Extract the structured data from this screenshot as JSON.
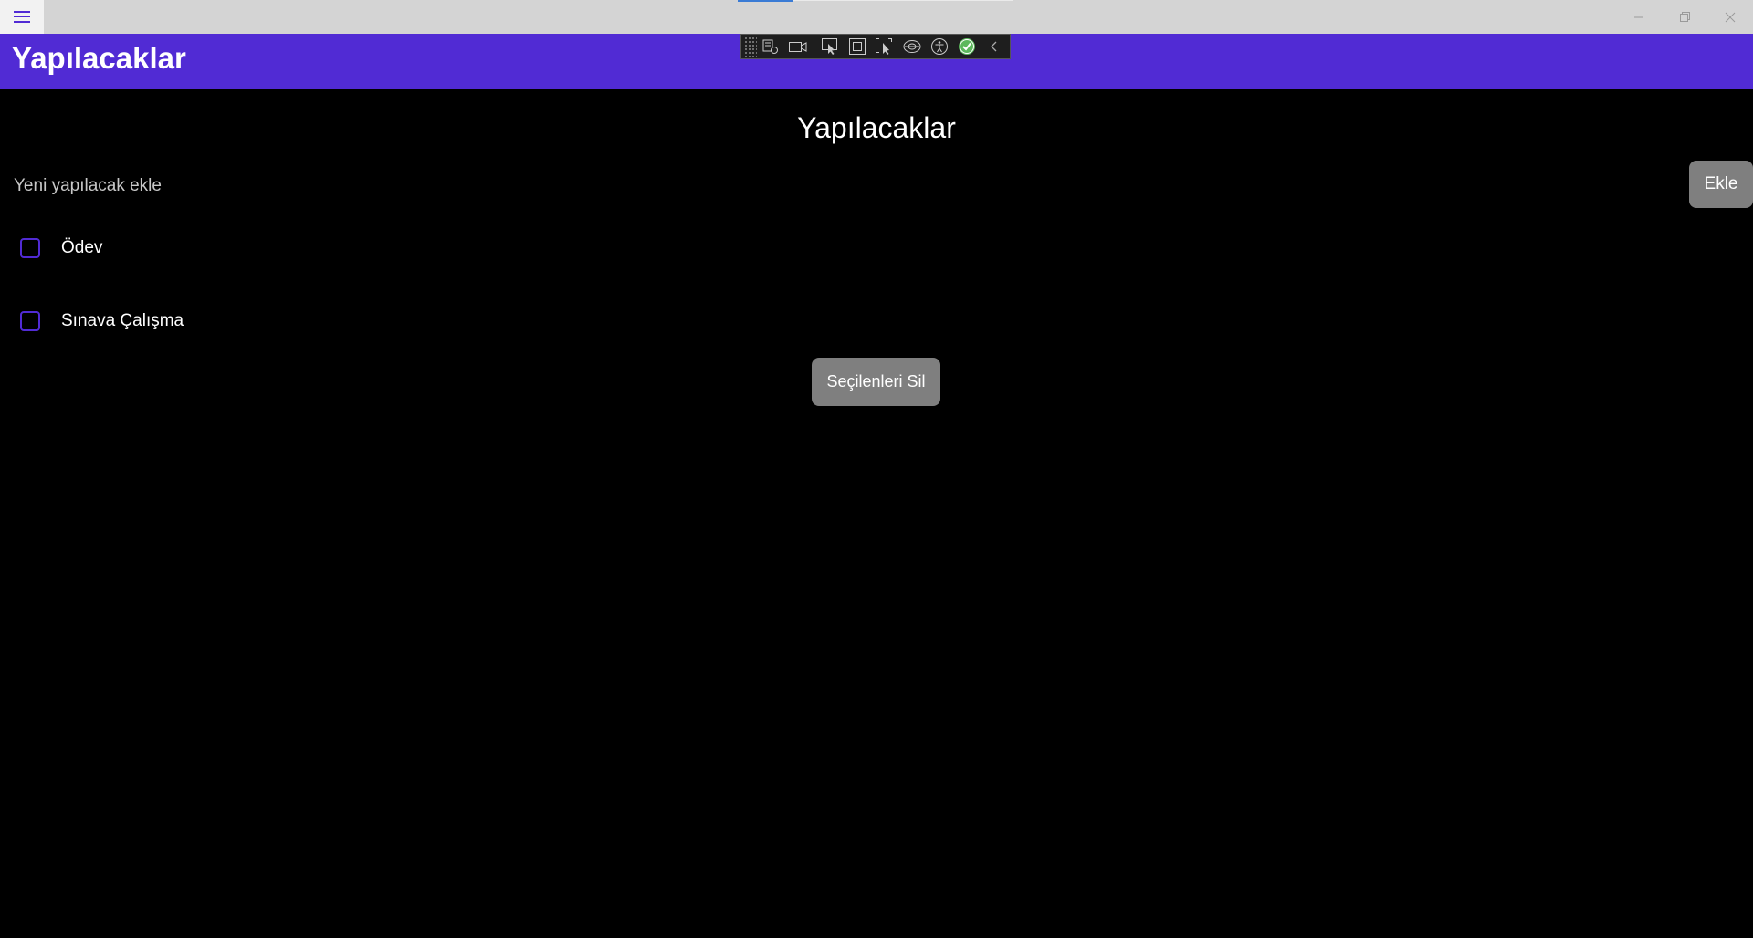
{
  "titlebar": {
    "menu_icon": "hamburger-icon",
    "controls": [
      "minimize-icon",
      "maximize-icon",
      "close-icon"
    ]
  },
  "header": {
    "title": "Yapılacaklar"
  },
  "devtoolbar": {
    "tools": [
      "live-visual-tree-icon",
      "record-icon",
      "select-element-icon",
      "display-layout-adorners-icon",
      "track-focus-icon",
      "binding-failures-icon",
      "accessibility-icon",
      "hot-reload-status-icon",
      "collapse-icon"
    ]
  },
  "main": {
    "page_title": "Yapılacaklar",
    "new_todo": {
      "placeholder": "Yeni yapılacak ekle",
      "value": ""
    },
    "add_button": "Ekle",
    "todos": [
      {
        "label": "Ödev",
        "checked": false
      },
      {
        "label": "Sınava Çalışma",
        "checked": false
      }
    ],
    "delete_button": "Seçilenleri Sil"
  },
  "colors": {
    "accent": "#512bd4",
    "button": "#7f7f7f",
    "background": "#000000"
  }
}
